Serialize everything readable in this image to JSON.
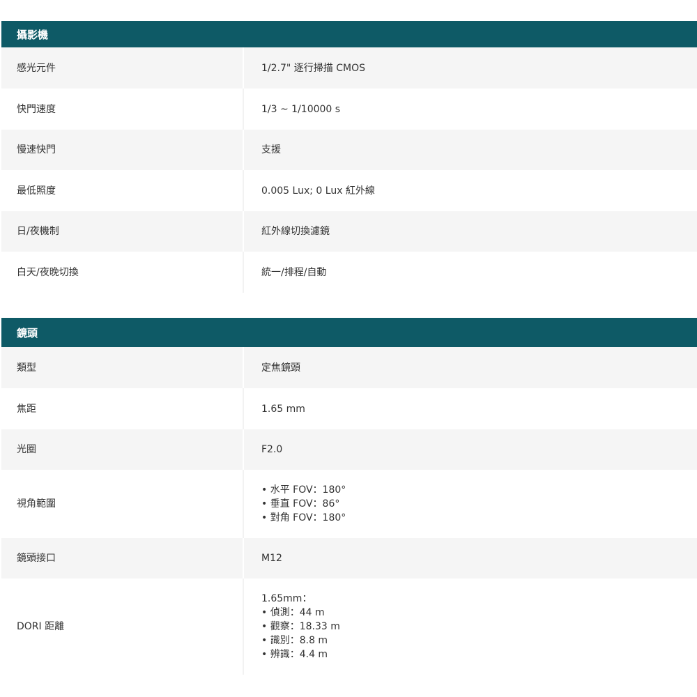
{
  "camera": {
    "title": "攝影機",
    "rows": [
      {
        "label": "感光元件",
        "value": [
          "1/2.7\" 逐行掃描 CMOS"
        ]
      },
      {
        "label": "快門速度",
        "value": [
          "1/3 ~ 1/10000 s"
        ]
      },
      {
        "label": "慢速快門",
        "value": [
          "支援"
        ]
      },
      {
        "label": "最低照度",
        "value": [
          "0.005 Lux; 0 Lux 紅外線"
        ]
      },
      {
        "label": "日/夜機制",
        "value": [
          "紅外線切換濾鏡"
        ]
      },
      {
        "label": "白天/夜晚切換",
        "value": [
          "統一/排程/自動"
        ]
      }
    ]
  },
  "lens": {
    "title": "鏡頭",
    "rows": [
      {
        "label": "類型",
        "value": [
          "定焦鏡頭"
        ]
      },
      {
        "label": "焦距",
        "value": [
          "1.65 mm"
        ]
      },
      {
        "label": "光圈",
        "value": [
          "F2.0"
        ]
      },
      {
        "label": "視角範圍",
        "value": [
          "• 水平 FOV：180°",
          "• 垂直 FOV：86°",
          "• 對角 FOV：180°"
        ]
      },
      {
        "label": "鏡頭接口",
        "value": [
          "M12"
        ]
      },
      {
        "label": "DORI 距離",
        "value": [
          "1.65mm：",
          "• 偵測：44 m",
          "• 觀察：18.33 m",
          "• 識別：8.8 m",
          "• 辨識：4.4 m"
        ]
      }
    ]
  }
}
